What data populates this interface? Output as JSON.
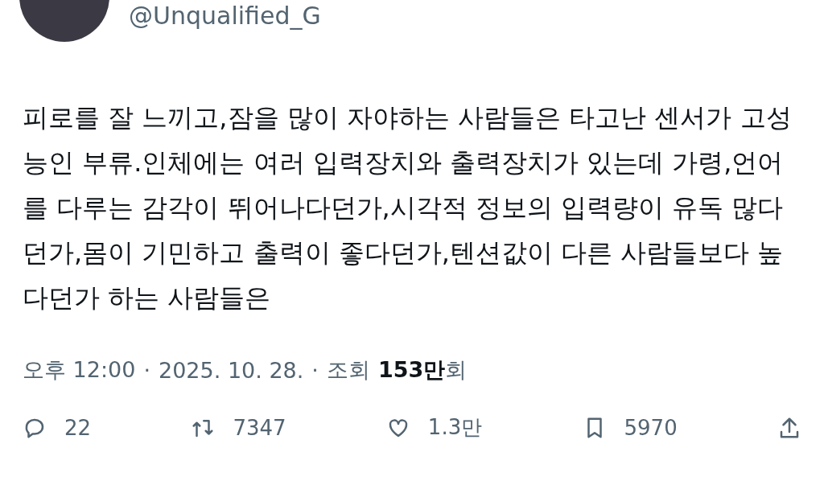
{
  "author": {
    "handle": "@Unqualified_G"
  },
  "tweet": {
    "text": "피로를 잘 느끼고,잠을 많이 자야하는 사람들은 타고난 센서가 고성능인 부류.인체에는 여러 입력장치와 출력장치가 있는데 가령,언어를 다루는 감각이 뛰어나다던가,시각적 정보의 입력량이 유독 많다던가,몸이 기민하고 출력이 좋다던가,텐션값이 다른 사람들보다 높다던가 하는 사람들은"
  },
  "meta": {
    "time": "오후 12:00",
    "separator": "·",
    "date": "2025. 10. 28.",
    "views_label": "조회",
    "views": "**153만**회"
  },
  "actions": [
    {
      "kind": "reply",
      "count": "22"
    },
    {
      "kind": "retweet",
      "count": "7347"
    },
    {
      "kind": "like",
      "count": "1.3만"
    },
    {
      "kind": "bookmark",
      "count": "5970"
    },
    {
      "kind": "share"
    }
  ]
}
